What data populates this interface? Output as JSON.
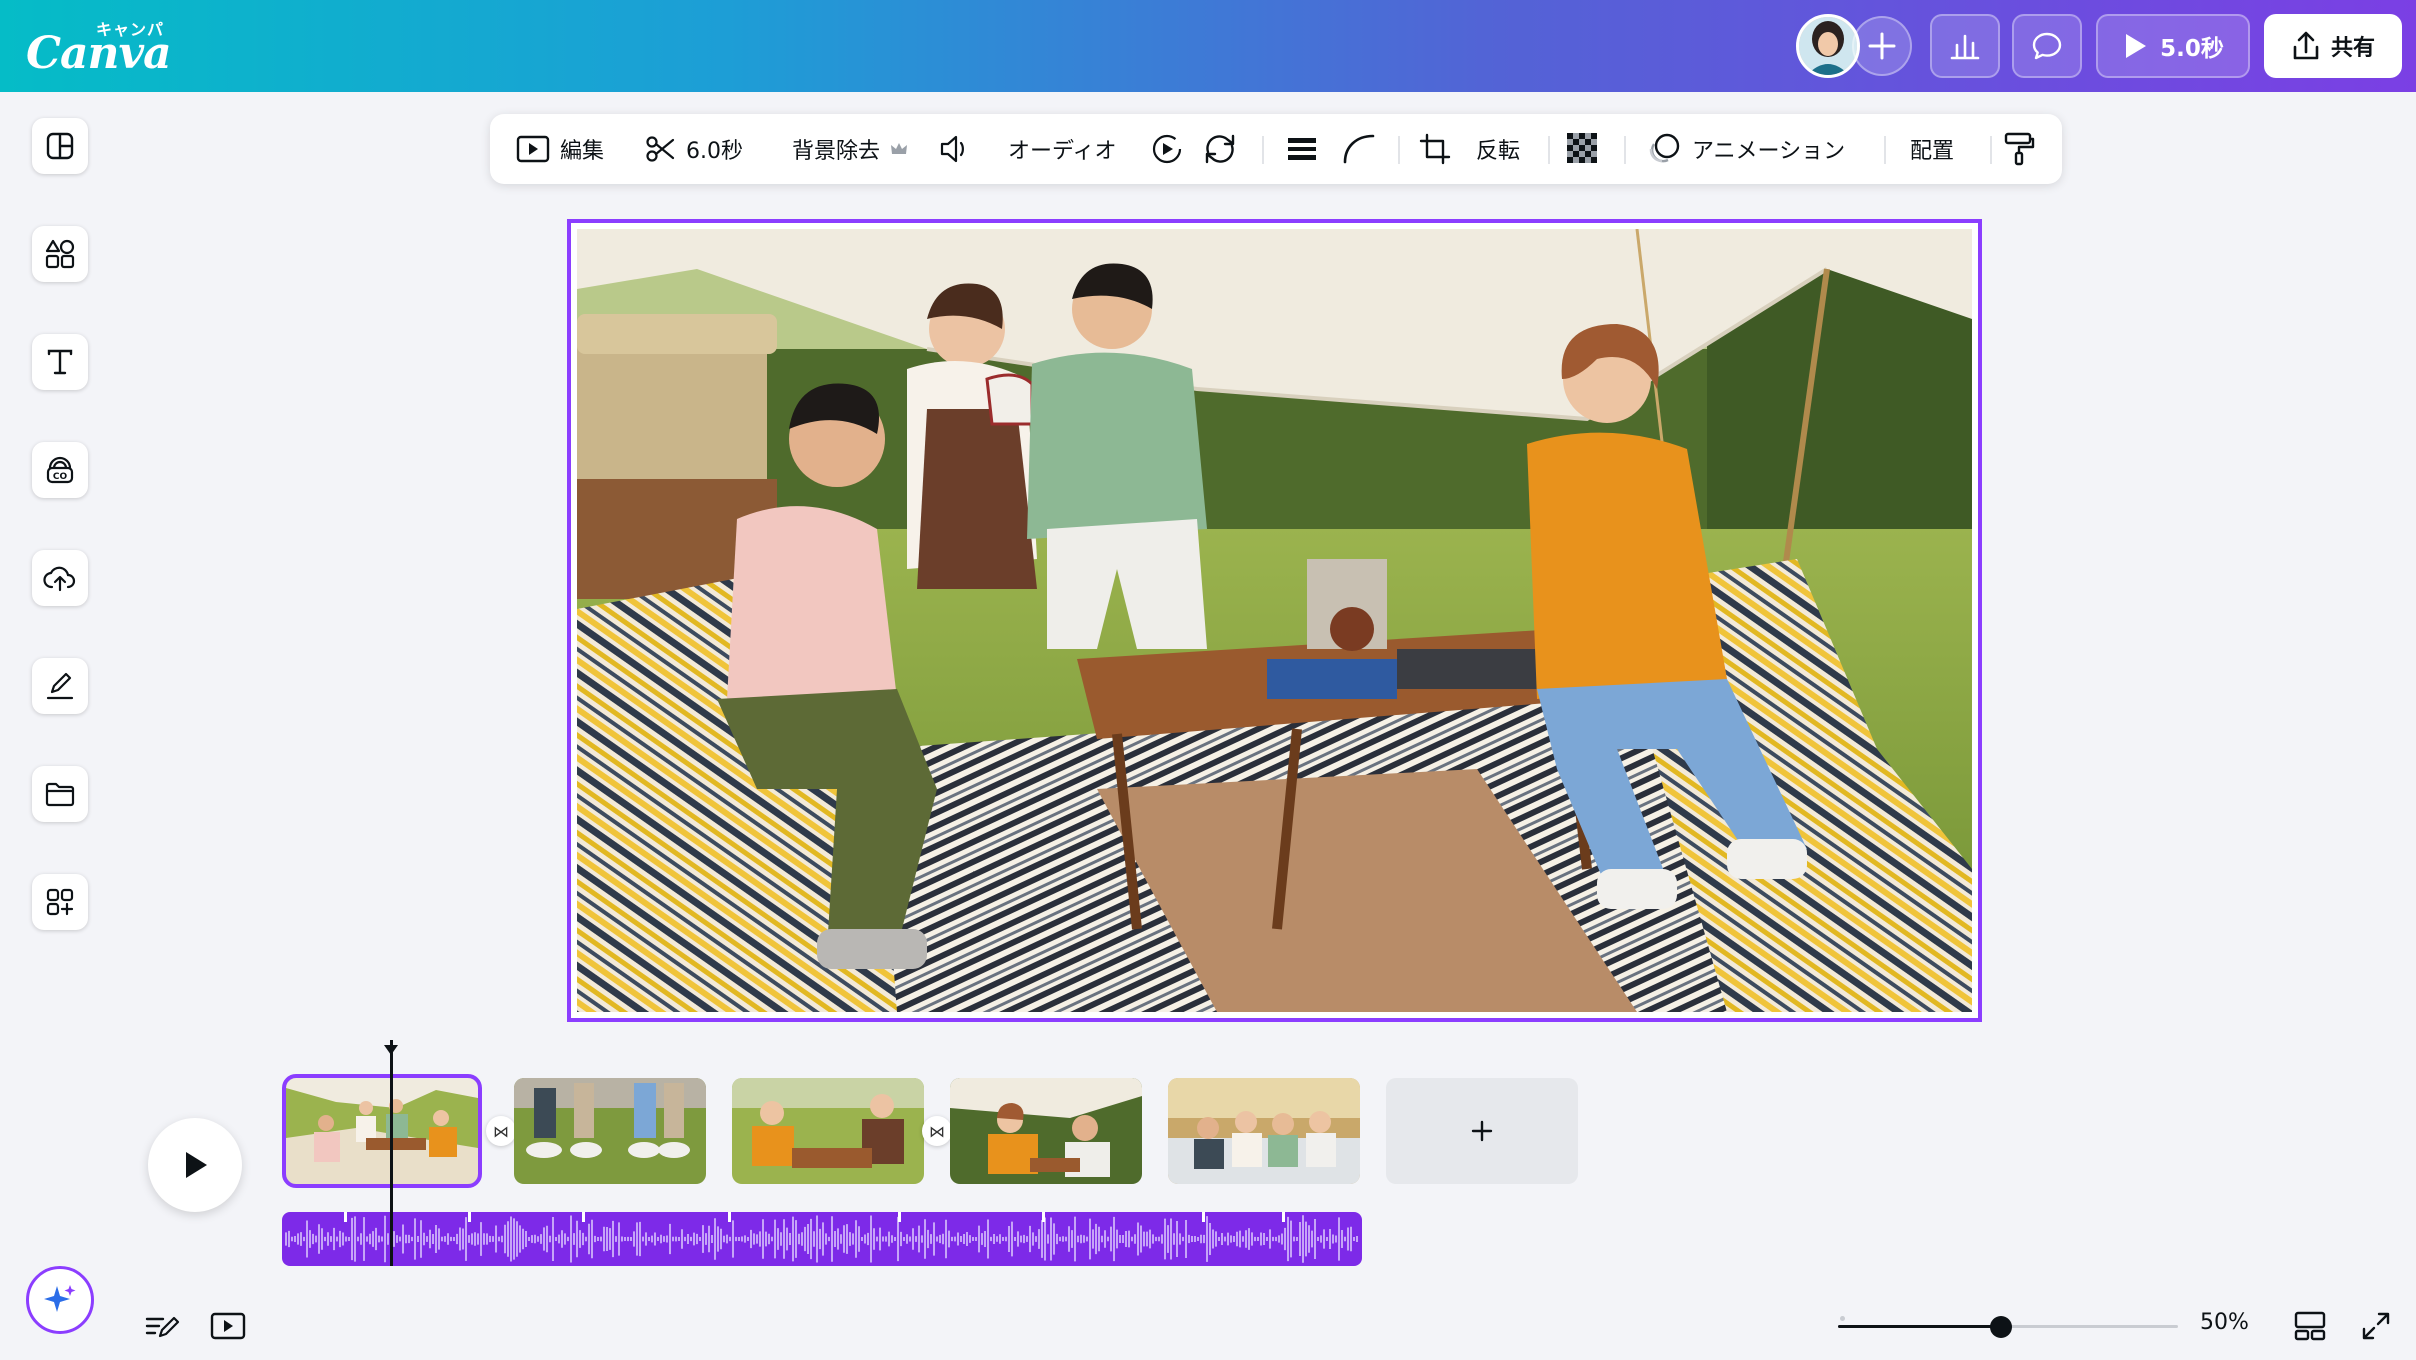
{
  "header": {
    "logo_text": "Canva",
    "logo_kana": "キャンパ",
    "play_label": "5.0秒",
    "share_label": "共有"
  },
  "toolbar": {
    "edit_label": "編集",
    "duration_label": "6.0秒",
    "bg_remove_label": "背景除去",
    "audio_label": "オーディオ",
    "flip_label": "反転",
    "animation_label": "アニメーション",
    "position_label": "配置"
  },
  "left_rail": [
    "layout-icon",
    "elements-icon",
    "text-icon",
    "brand-icon",
    "uploads-icon",
    "draw-icon",
    "projects-icon",
    "apps-icon"
  ],
  "timeline": {
    "clip_count": 5,
    "selected_clip": 1,
    "add_page_symbol": "+"
  },
  "footer": {
    "zoom_label": "50%",
    "zoom_fraction": 0.48
  },
  "colors": {
    "accent": "#8b3dff",
    "audio": "#7d2ae8",
    "header_start": "#05bcc7",
    "header_end": "#7b3fe4"
  }
}
